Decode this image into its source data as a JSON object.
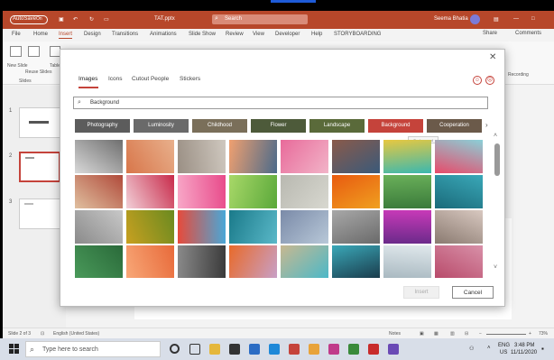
{
  "titlebar": {
    "autosave": "AutoSave",
    "autosave_state": "On",
    "filename": "TAT.pptx",
    "search_placeholder": "Search",
    "user": "Seema Bhatia"
  },
  "menu": {
    "items": [
      "File",
      "Home",
      "Insert",
      "Design",
      "Transitions",
      "Animations",
      "Slide Show",
      "Review",
      "View",
      "Developer",
      "Help",
      "STORYBOARDING"
    ],
    "active": "Insert",
    "share": "Share",
    "comments": "Comments"
  },
  "ribbon": {
    "new_slide": "New Slide",
    "reuse_slides": "Reuse Slides",
    "group_slides": "Slides",
    "table": "Table",
    "recording": "Recording"
  },
  "thumbnails": [
    "1",
    "2",
    "3"
  ],
  "statusbar": {
    "slide_info": "Slide 2 of 3",
    "language": "English (United States)",
    "notes": "Notes",
    "zoom": "73%"
  },
  "taskbar": {
    "search_placeholder": "Type here to search",
    "lang": "ENG",
    "region": "US",
    "time": "3:48 PM",
    "date": "11/11/2020"
  },
  "dialog": {
    "tabs": [
      "Images",
      "Icons",
      "Cutout People",
      "Stickers"
    ],
    "active_tab": "Images",
    "search_value": "Background",
    "categories": [
      {
        "label": "Photography",
        "color": "#5c5c5c"
      },
      {
        "label": "Luminosity",
        "color": "#6a6a6a"
      },
      {
        "label": "Childhood",
        "color": "#7a6f5a"
      },
      {
        "label": "Flower",
        "color": "#4d5a3a"
      },
      {
        "label": "Landscape",
        "color": "#5a6a3a"
      },
      {
        "label": "Background",
        "color": "#c5433b"
      },
      {
        "label": "Cooperation",
        "color": "#6b5a4a"
      }
    ],
    "tooltip": "Background",
    "insert_label": "Insert",
    "cancel_label": "Cancel"
  }
}
